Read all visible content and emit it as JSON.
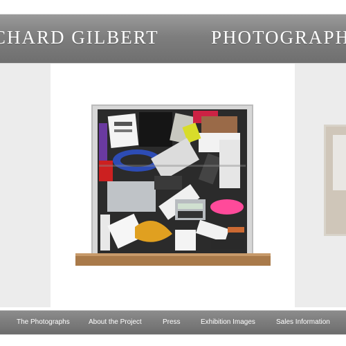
{
  "header": {
    "name": "CHARD GILBERT",
    "subtitle": "PHOTOGRAPH"
  },
  "gallery": {
    "main_photo_icon": "drawer-photo",
    "next_photo_icon": "framed-photo-thumbnail"
  },
  "nav": {
    "items": [
      {
        "label": "The Photographs"
      },
      {
        "label": "About the Project"
      },
      {
        "label": "Press"
      },
      {
        "label": "Exhibition Images"
      },
      {
        "label": "Sales Information"
      }
    ]
  },
  "colors": {
    "header_band": "#7e7e7e",
    "nav_band": "#7a7a7a",
    "gallery_bg": "#ececec",
    "text": "#ffffff"
  }
}
